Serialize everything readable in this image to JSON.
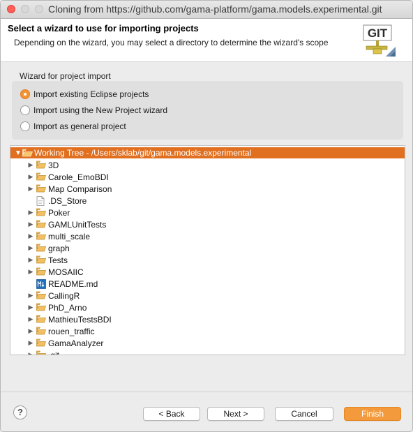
{
  "window": {
    "title": "Cloning from https://github.com/gama-platform/gama.models.experimental.git"
  },
  "header": {
    "title": "Select a wizard to use for importing projects",
    "description": "Depending on the wizard, you may select a directory to determine the wizard's scope",
    "logo_text": "GIT"
  },
  "wizard_group": {
    "label": "Wizard for project import",
    "options": [
      {
        "label": "Import existing Eclipse projects",
        "selected": true
      },
      {
        "label": "Import using the New Project wizard",
        "selected": false
      },
      {
        "label": "Import as general project",
        "selected": false
      }
    ]
  },
  "tree": {
    "root": {
      "label": "Working Tree - /Users/sklab/git/gama.models.experimental",
      "expanded": true
    },
    "items": [
      {
        "label": "3D",
        "type": "folder"
      },
      {
        "label": "Carole_EmoBDI",
        "type": "folder"
      },
      {
        "label": "Map Comparison",
        "type": "folder"
      },
      {
        "label": ".DS_Store",
        "type": "file"
      },
      {
        "label": "Poker",
        "type": "folder"
      },
      {
        "label": "GAMLUnitTests",
        "type": "folder"
      },
      {
        "label": "multi_scale",
        "type": "folder"
      },
      {
        "label": "graph",
        "type": "folder"
      },
      {
        "label": "Tests",
        "type": "folder"
      },
      {
        "label": "MOSAIIC",
        "type": "folder"
      },
      {
        "label": "README.md",
        "type": "markdown"
      },
      {
        "label": "CallingR",
        "type": "folder"
      },
      {
        "label": "PhD_Arno",
        "type": "folder"
      },
      {
        "label": "MathieuTestsBDI",
        "type": "folder"
      },
      {
        "label": "rouen_traffic",
        "type": "folder"
      },
      {
        "label": "GamaAnalyzer",
        "type": "folder"
      },
      {
        "label": ".git",
        "type": "folder"
      }
    ]
  },
  "footer": {
    "help_label": "?",
    "back_label": "< Back",
    "next_label": "Next >",
    "cancel_label": "Cancel",
    "finish_label": "Finish"
  },
  "colors": {
    "accent": "#e06f1f",
    "finish": "#f39a3d",
    "close": "#fe5f57"
  }
}
